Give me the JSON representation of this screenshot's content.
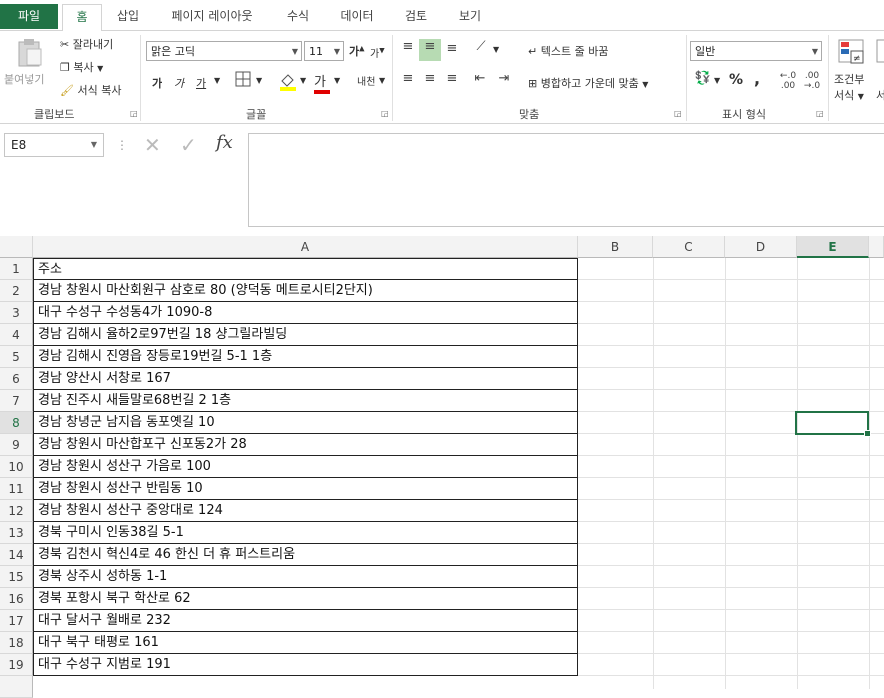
{
  "tabs": [
    "파일",
    "홈",
    "삽입",
    "페이지 레이아웃",
    "수식",
    "데이터",
    "검토",
    "보기"
  ],
  "ribbon": {
    "clipboard": {
      "paste": "붙여넣기",
      "cut": "잘라내기",
      "copy": "복사",
      "format_painter": "서식 복사",
      "label": "클립보드"
    },
    "font": {
      "name": "맑은 고딕",
      "size": "11",
      "grow": "가",
      "shrink": "가",
      "bold": "가",
      "italic": "가",
      "underline": "가",
      "font_color": "가",
      "phonetic": "내천",
      "label": "글꼴"
    },
    "alignment": {
      "wrap_text": "텍스트 줄 바꿈",
      "merge_center": "병합하고 가운데 맞춤",
      "label": "맞춤"
    },
    "number": {
      "format": "일반",
      "percent": "%",
      "comma": ",",
      "label": "표시 형식"
    },
    "styles": {
      "conditional_line1": "조건부",
      "conditional_line2": "서식",
      "next": "서"
    }
  },
  "formula_bar": {
    "name_box": "E8",
    "fx": "fx",
    "value": ""
  },
  "sheet": {
    "columns": [
      "A",
      "B",
      "C",
      "D",
      "E"
    ],
    "selected_column": "E",
    "selected_row": "8",
    "rows": [
      {
        "n": "1",
        "a": "주소"
      },
      {
        "n": "2",
        "a": "경남 창원시 마산회원구 삼호로 80 (양덕동 메트로시티2단지)"
      },
      {
        "n": "3",
        "a": "대구 수성구 수성동4가 1090-8"
      },
      {
        "n": "4",
        "a": "경남 김해시 율하2로97번길 18 샹그릴라빌딩"
      },
      {
        "n": "5",
        "a": "경남 김해시 진영읍 장등로19번길 5-1 1층"
      },
      {
        "n": "6",
        "a": "경남 양산시 서창로 167"
      },
      {
        "n": "7",
        "a": "경남 진주시 새들말로68번길 2 1층"
      },
      {
        "n": "8",
        "a": "경남 창녕군 남지읍 동포옛길 10"
      },
      {
        "n": "9",
        "a": "경남 창원시 마산합포구 신포동2가 28"
      },
      {
        "n": "10",
        "a": "경남 창원시 성산구 가음로 100"
      },
      {
        "n": "11",
        "a": "경남 창원시 성산구 반림동 10"
      },
      {
        "n": "12",
        "a": "경남 창원시 성산구 중앙대로 124"
      },
      {
        "n": "13",
        "a": "경북 구미시 인동38길 5-1"
      },
      {
        "n": "14",
        "a": "경북 김천시 혁신4로 46 한신 더 휴 퍼스트리움"
      },
      {
        "n": "15",
        "a": "경북 상주시 성하동 1-1"
      },
      {
        "n": "16",
        "a": "경북 포항시 북구 학산로 62"
      },
      {
        "n": "17",
        "a": "대구 달서구 월배로 232"
      },
      {
        "n": "18",
        "a": "대구 북구 태평로 161"
      },
      {
        "n": "19",
        "a": "대구 수성구 지범로 191"
      }
    ]
  }
}
